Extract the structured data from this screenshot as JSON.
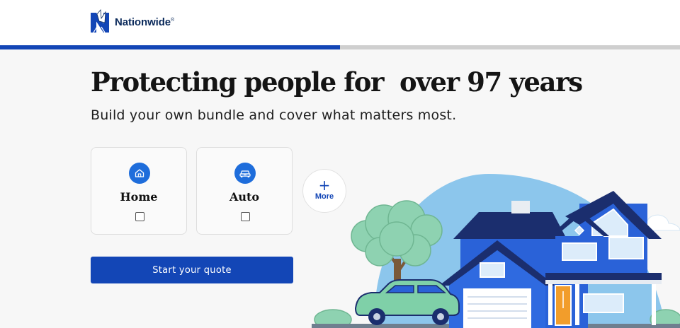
{
  "brand": {
    "name": "Nationwide",
    "registered": "®",
    "colors": {
      "primary": "#1346b6",
      "accent": "#1e6ddb",
      "navy": "#0b2a5b"
    }
  },
  "progress": {
    "fraction": 0.5
  },
  "hero": {
    "headline": "Protecting people for  over 97 years",
    "subhead": "Build your own bundle and cover what matters most."
  },
  "products": [
    {
      "label": "Home",
      "icon": "house-icon",
      "checked": false
    },
    {
      "label": "Auto",
      "icon": "car-icon",
      "checked": false
    }
  ],
  "more": {
    "symbol": "+",
    "label": "More"
  },
  "cta": {
    "label": "Start your quote"
  }
}
